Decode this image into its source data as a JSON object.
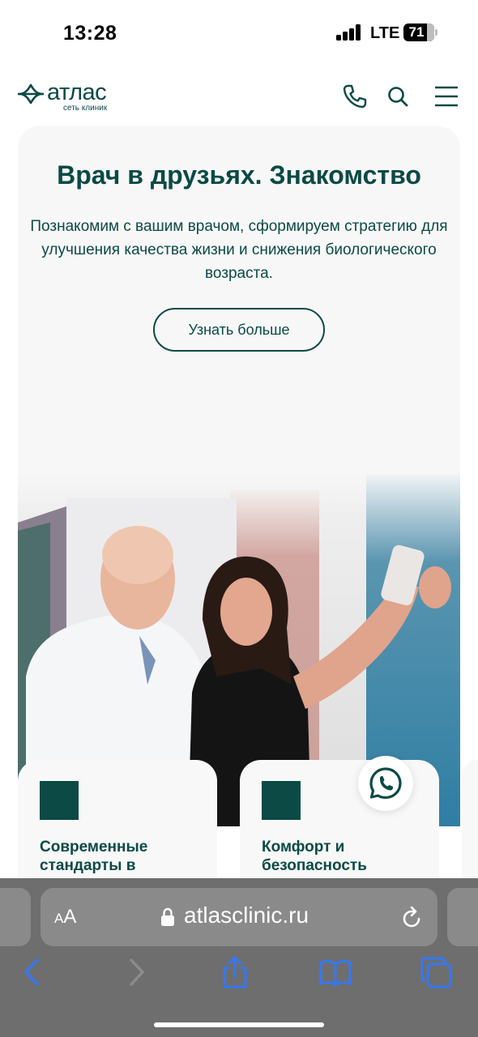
{
  "status_bar": {
    "time": "13:28",
    "network": "LTE",
    "battery": "71"
  },
  "site": {
    "logo_name": "атлас",
    "logo_subtitle": "сеть клиник"
  },
  "header_icons": {
    "phone": "phone-icon",
    "search": "search-icon",
    "menu": "hamburger-menu-icon"
  },
  "hero": {
    "title": "Врач в друзьях. Знакомство",
    "description": "Познакомим с вашим врачом, сформируем стратегию для улучшения качества жизни и снижения биологического возраста.",
    "button_label": "Узнать больше"
  },
  "feature_cards": [
    {
      "title": "Современные стандарты в"
    },
    {
      "title": "Комфорт и безопасность"
    }
  ],
  "whatsapp": {
    "icon": "whatsapp-icon"
  },
  "browser": {
    "text_size_label_small": "A",
    "text_size_label_big": "A",
    "url": "atlasclinic.ru"
  },
  "colors": {
    "brand": "#0b4a45",
    "card_bg": "#f8f8f8",
    "safari_bar": "#6e6e6e",
    "safari_blue": "#3478f6"
  }
}
